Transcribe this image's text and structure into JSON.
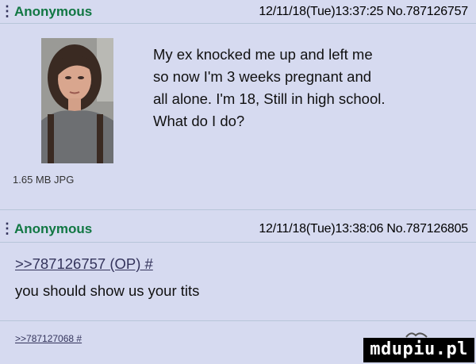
{
  "post1": {
    "name": "Anonymous",
    "dateline": "12/11/18(Tue)13:37:25 No.787126757",
    "comment_lines": [
      "My ex knocked me up and left me",
      "so now I'm 3 weeks pregnant and",
      "all alone. I'm 18, Still in high school.",
      "What do I do?"
    ],
    "fileinfo": "1.65 MB JPG",
    "thumbnail_icon": "photo-of-person"
  },
  "post2": {
    "name": "Anonymous",
    "dateline": "12/11/18(Tue)13:38:06 No.787126805",
    "quotelink": ">>787126757 (OP) #",
    "comment": "you should show us your tits"
  },
  "post3": {
    "quotelink": ">>787127068 #"
  },
  "watermark": "mdupiu.pl",
  "colors": {
    "background": "#d6daf0",
    "name": "#117743",
    "link": "#34345c",
    "border": "#b7c5d9"
  }
}
